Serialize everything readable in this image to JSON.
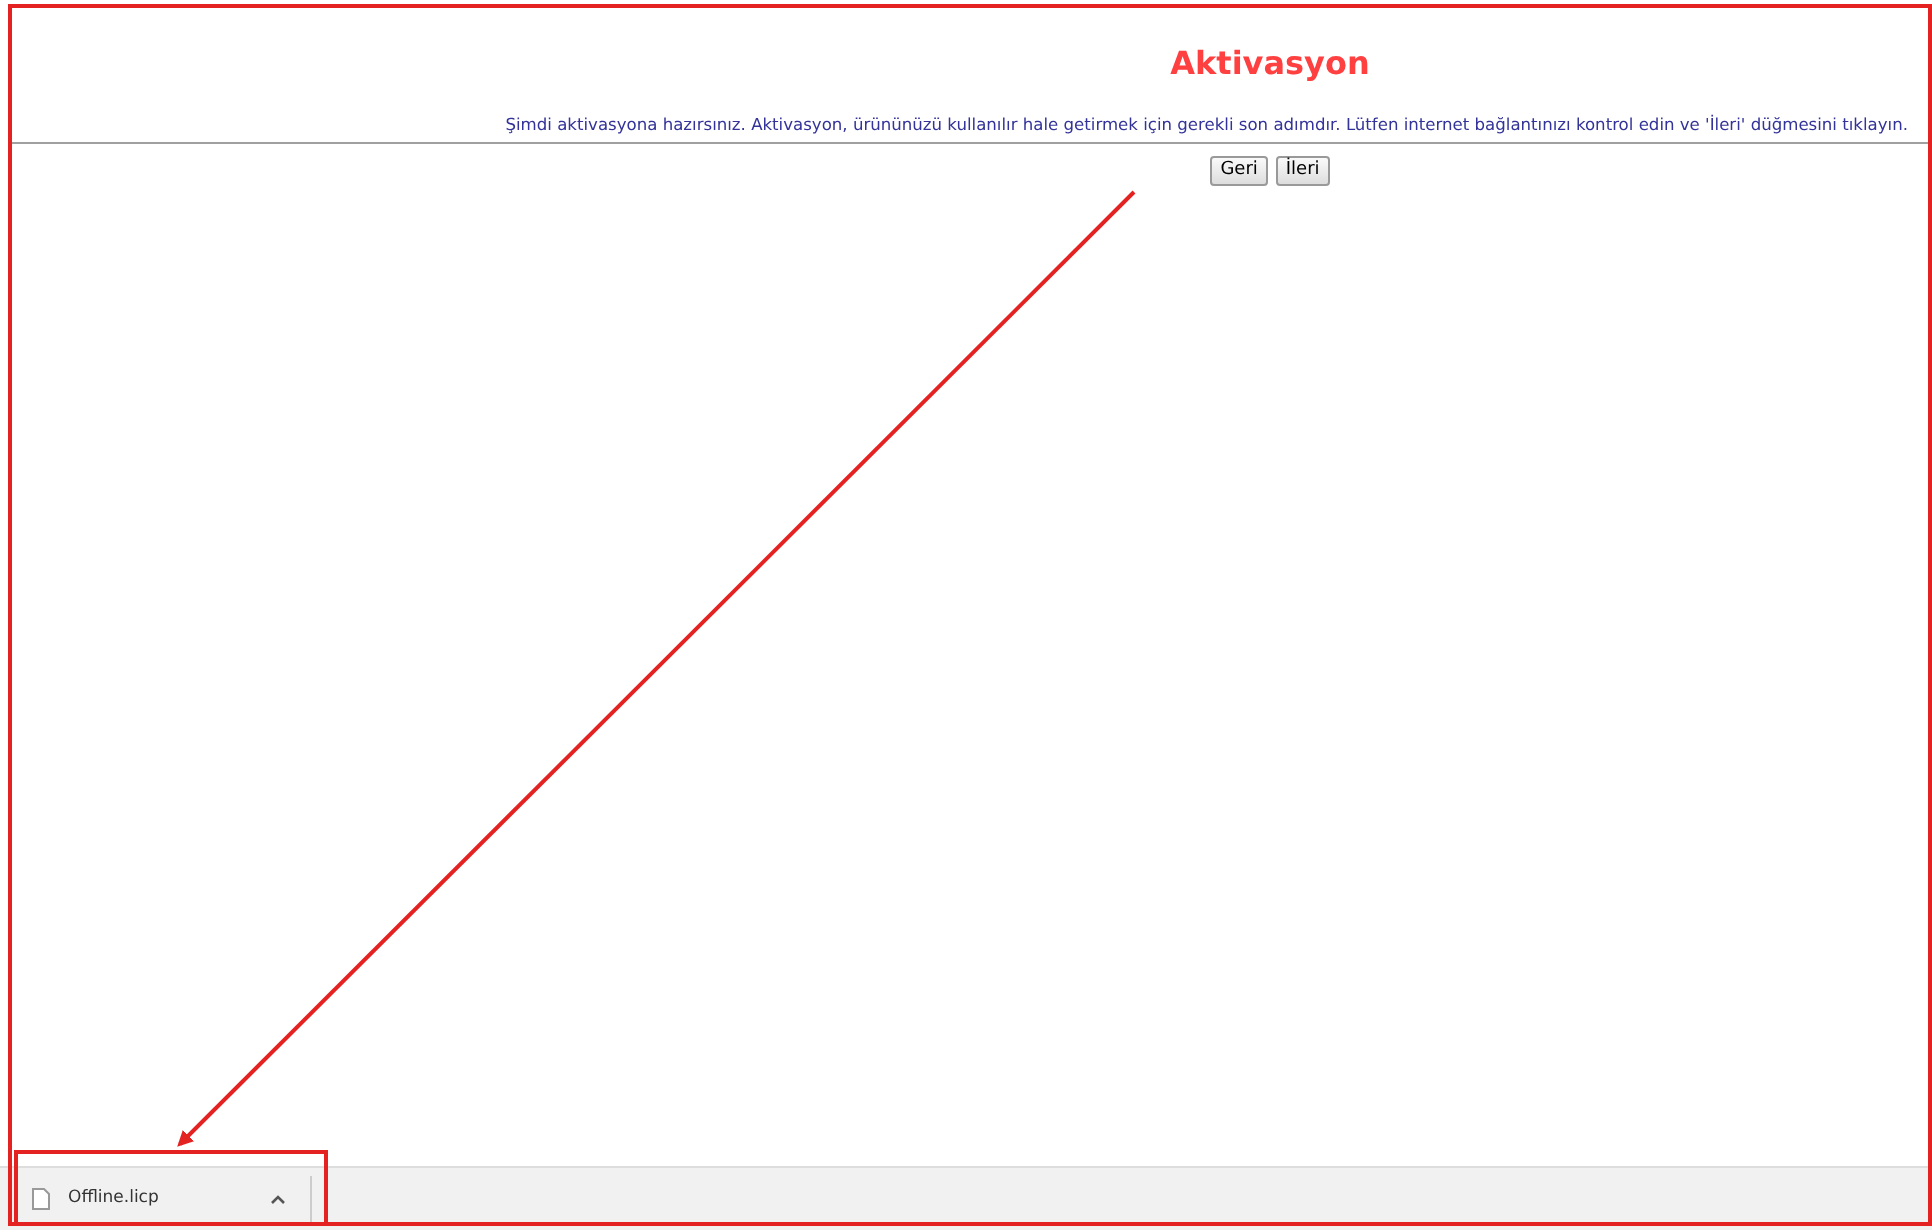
{
  "page": {
    "title": "Aktivasyon",
    "message": "Şimdi aktivasyona hazırsınız. Aktivasyon, ürününüzü kullanılır hale getirmek için gerekli son adımdır. Lütfen internet bağlantınızı kontrol edin ve 'İleri' düğmesini tıklayın.",
    "buttons": [
      "Geri",
      "İleri"
    ]
  },
  "download_bar": {
    "items": [
      {
        "file_name": "Offline.licp"
      }
    ]
  }
}
